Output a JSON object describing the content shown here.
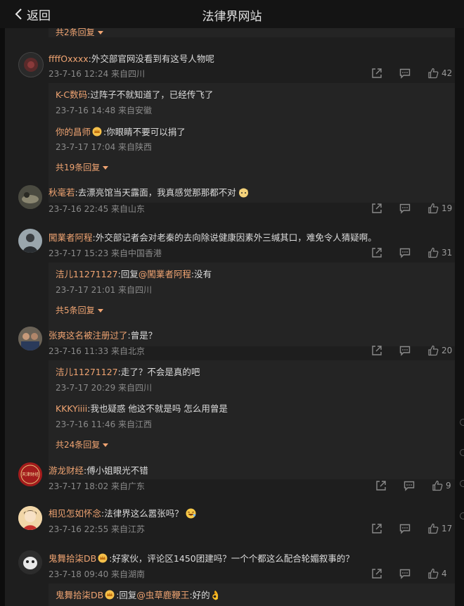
{
  "header": {
    "back_label": "返回",
    "title": "法律界网站"
  },
  "top_more": "共2条回复",
  "comments": [
    {
      "name": "ffffOxxxx",
      "text": ":外交部官网没看到有这号人物呢",
      "meta": "23-7-16 12:24 来自四川",
      "likes": "42",
      "replies": [
        {
          "name": "K-C数码",
          "text": ":过阵子不就知道了，已经传飞了",
          "meta": "23-7-16 14:48 来自安徽"
        },
        {
          "name": "你的昌师",
          "text": ":你眼睛不要可以捐了",
          "meta": "23-7-17 17:04 来自陕西"
        }
      ],
      "more": "共19条回复"
    },
    {
      "name": "秋毫若",
      "text": ":去漂亮馆当天露面，我真感觉那那都不对",
      "meta": "23-7-16 22:45 来自山东",
      "likes": "19"
    },
    {
      "name": "闖業者阿程",
      "text": ":外交部记者会对老秦的去向除说健康因素外三缄其口，难免令人猜疑啊。",
      "meta": "23-7-17 15:23 来自中国香港",
      "likes": "31",
      "replies": [
        {
          "name": "洁儿11271127",
          "text": ":回复",
          "at": "@闖業者阿程",
          "text2": ":没有",
          "meta": "23-7-17 21:01 来自四川"
        }
      ],
      "more": "共5条回复"
    },
    {
      "name": "张爽这名被注册过了",
      "text": ":曾是？",
      "meta": "23-7-16 11:33 来自北京",
      "likes": "20",
      "replies": [
        {
          "name": "洁儿11271127",
          "text": ":走了？不会是真的吧",
          "meta": "23-7-17 20:29 来自四川"
        },
        {
          "name": "KKKYiiii",
          "text": ":我也疑惑 他这不就是吗 怎么用曾是",
          "meta": "23-7-16 11:46 来自江西"
        }
      ],
      "more": "共24条回复"
    },
    {
      "name": "游龙财经",
      "text": ":傅小姐眼光不错",
      "meta": "23-7-17 18:02 来自广东",
      "likes": "9"
    },
    {
      "name": "相见怎如怀念",
      "text": ":法律界这么嚣张吗？",
      "meta": "23-7-16 22:55 来自江苏",
      "likes": "17"
    },
    {
      "name": "鬼舞拾柒DB",
      "text": ":好家伙，评论区1450团建吗？一个个都这么配合轮媚叙事的？",
      "meta": "23-7-18 09:40 来自湖南",
      "likes": "4",
      "replies": [
        {
          "name": "鬼舞拾柒DB",
          "text": ":回复",
          "at": "@虫草鹿鞭王",
          "text2": ":好的👌"
        }
      ]
    }
  ],
  "avatar_text_3": "天津财经",
  "colors": {
    "accent": "#f0a472",
    "meta": "#8a8a8a",
    "panel": "#1e1e1e",
    "reply_bg": "#242424"
  },
  "icons": [
    "back-chevron-icon",
    "share-icon",
    "comment-icon",
    "like-icon",
    "crown-badge-icon",
    "emoji-icon"
  ]
}
